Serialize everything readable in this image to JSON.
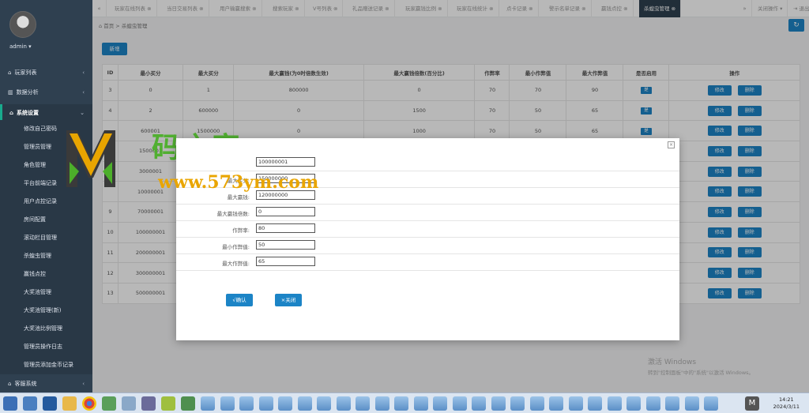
{
  "sidebar": {
    "user": "admin",
    "menu": [
      {
        "label": "玩家列表",
        "icon": "home-icon"
      },
      {
        "label": "数据分析",
        "icon": "chart-icon"
      },
      {
        "label": "系统设置",
        "icon": "home-icon"
      }
    ],
    "submenu": [
      "修改自己密码",
      "管理员管理",
      "角色管理",
      "平台前端记录",
      "用户点控记录",
      "房间配置",
      "滚动栏目管理",
      "杀蝗虫管理",
      "赢钱点控",
      "大奖池管理",
      "大奖池管理(新)",
      "大奖池比例管理",
      "管理员操作日志",
      "管理员添加金币记录"
    ],
    "bottom_menu": {
      "label": "客服系统",
      "icon": "home-icon"
    }
  },
  "tabs": [
    "玩家在线列表",
    "当日交易列表",
    "用户输赢搜索",
    "搜索玩家",
    "V号列表",
    "礼品赠送记录",
    "玩家赢钱比例",
    "玩家在线统计",
    "点卡记录",
    "警示名单记录",
    "赢钱点控",
    "杀蝗虫管理"
  ],
  "tab_right": {
    "close_ops": "关闭操作",
    "logout": "退出"
  },
  "breadcrumb": {
    "home": "首页",
    "current": "杀蝗虫管理"
  },
  "new_button": "新增",
  "table": {
    "headers": [
      "ID",
      "最小买分",
      "最大买分",
      "最大赢钱(为0时倍数生效)",
      "最大赢钱倍数(百分比)",
      "作弊率",
      "最小作弊值",
      "最大作弊值",
      "是否启用",
      "操作"
    ],
    "rows": [
      [
        "3",
        "0",
        "1",
        "800000",
        "0",
        "70",
        "70",
        "90",
        "是"
      ],
      [
        "4",
        "2",
        "600000",
        "0",
        "1500",
        "70",
        "50",
        "65",
        "是"
      ],
      [
        "",
        "600001",
        "1500000",
        "0",
        "1000",
        "70",
        "50",
        "65",
        "是"
      ],
      [
        "",
        "1500001",
        "",
        "",
        "",
        "",
        "",
        "",
        ""
      ],
      [
        "",
        "3000001",
        "",
        "",
        "",
        "",
        "",
        "",
        ""
      ],
      [
        "",
        "10000001",
        "",
        "",
        "",
        "",
        "",
        "",
        ""
      ],
      [
        "9",
        "70000001",
        "",
        "",
        "",
        "",
        "",
        "",
        ""
      ],
      [
        "10",
        "100000001",
        "",
        "",
        "",
        "",
        "",
        "",
        ""
      ],
      [
        "11",
        "200000001",
        "",
        "",
        "",
        "",
        "",
        "",
        ""
      ],
      [
        "12",
        "300000001",
        "",
        "",
        "",
        "",
        "",
        "",
        ""
      ],
      [
        "13",
        "500000001",
        "",
        "",
        "",
        "",
        "",
        "",
        ""
      ]
    ],
    "edit_label": "修改",
    "delete_label": "删除"
  },
  "modal": {
    "fields": [
      {
        "label": "",
        "value": "100000001"
      },
      {
        "label": "最大买分:",
        "value": "150000000"
      },
      {
        "label": "最大赢钱:",
        "value": "120000000"
      },
      {
        "label": "最大赢钱倍数:",
        "value": "0"
      },
      {
        "label": "作弊率:",
        "value": "80"
      },
      {
        "label": "最小作弊值:",
        "value": "50"
      },
      {
        "label": "最大作弊值:",
        "value": "65"
      }
    ],
    "confirm": "√确认",
    "close": "×关闭"
  },
  "watermark": {
    "title": "码之家",
    "url": "www.573ym.com"
  },
  "windows": {
    "line1": "激活 Windows",
    "line2": "转到\"控制面板\"中的\"系统\"以激活 Windows。"
  },
  "clock": {
    "time": "14:21",
    "date": "2024/3/11"
  },
  "colors": {
    "sidebar": "#2f4050",
    "primary": "#1c84c6",
    "accent": "#19aa8d"
  }
}
